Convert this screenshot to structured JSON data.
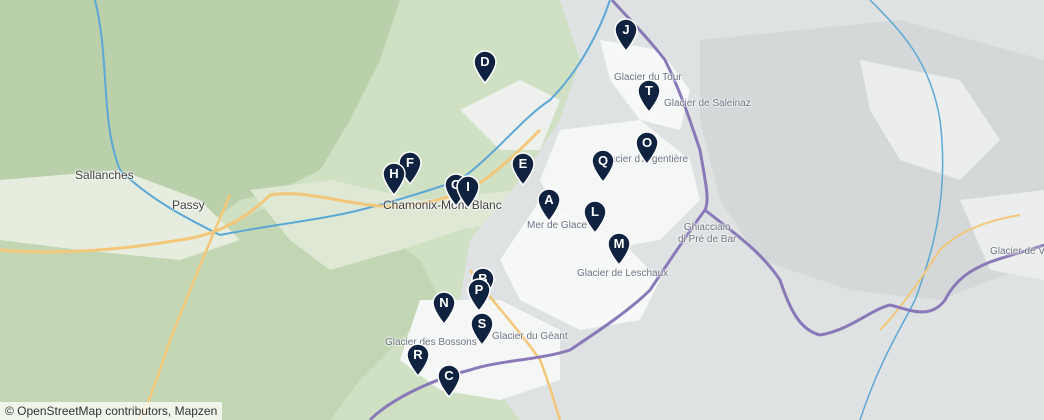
{
  "map": {
    "places": [
      {
        "id": "sallanches",
        "text": "Sallanches",
        "type": "town"
      },
      {
        "id": "passy",
        "text": "Passy",
        "type": "town"
      },
      {
        "id": "chamonix",
        "text": "Chamonix-Mont-Blanc",
        "type": "town"
      },
      {
        "id": "glacier-tour",
        "text": "Glacier du Tour",
        "type": "glacier"
      },
      {
        "id": "glacier-saleinaz",
        "text": "Glacier de Saleinaz",
        "type": "glacier"
      },
      {
        "id": "glacier-argentiere",
        "text": "Glacier d'Argentière",
        "type": "glacier"
      },
      {
        "id": "mer-de-glace",
        "text": "Mer de Glace",
        "type": "glacier"
      },
      {
        "id": "ghiacciaio",
        "text": "Ghiacciaio\ndi Pré de Bar",
        "type": "glacier"
      },
      {
        "id": "glacier-leschaux",
        "text": "Glacier de Leschaux",
        "type": "glacier"
      },
      {
        "id": "glacier-geant",
        "text": "Glacier du Géant",
        "type": "glacier"
      },
      {
        "id": "glacier-bossons",
        "text": "Glacier des Bossons",
        "type": "glacier"
      },
      {
        "id": "glacier-v",
        "text": "Glacier de V",
        "type": "glacier"
      }
    ],
    "markers": [
      "A",
      "B",
      "C",
      "D",
      "E",
      "F",
      "G",
      "H",
      "I",
      "J",
      "L",
      "M",
      "N",
      "O",
      "P",
      "Q",
      "R",
      "S",
      "T"
    ],
    "marker_color": "#0f2340",
    "attribution": "© OpenStreetMap contributors, Mapzen"
  }
}
